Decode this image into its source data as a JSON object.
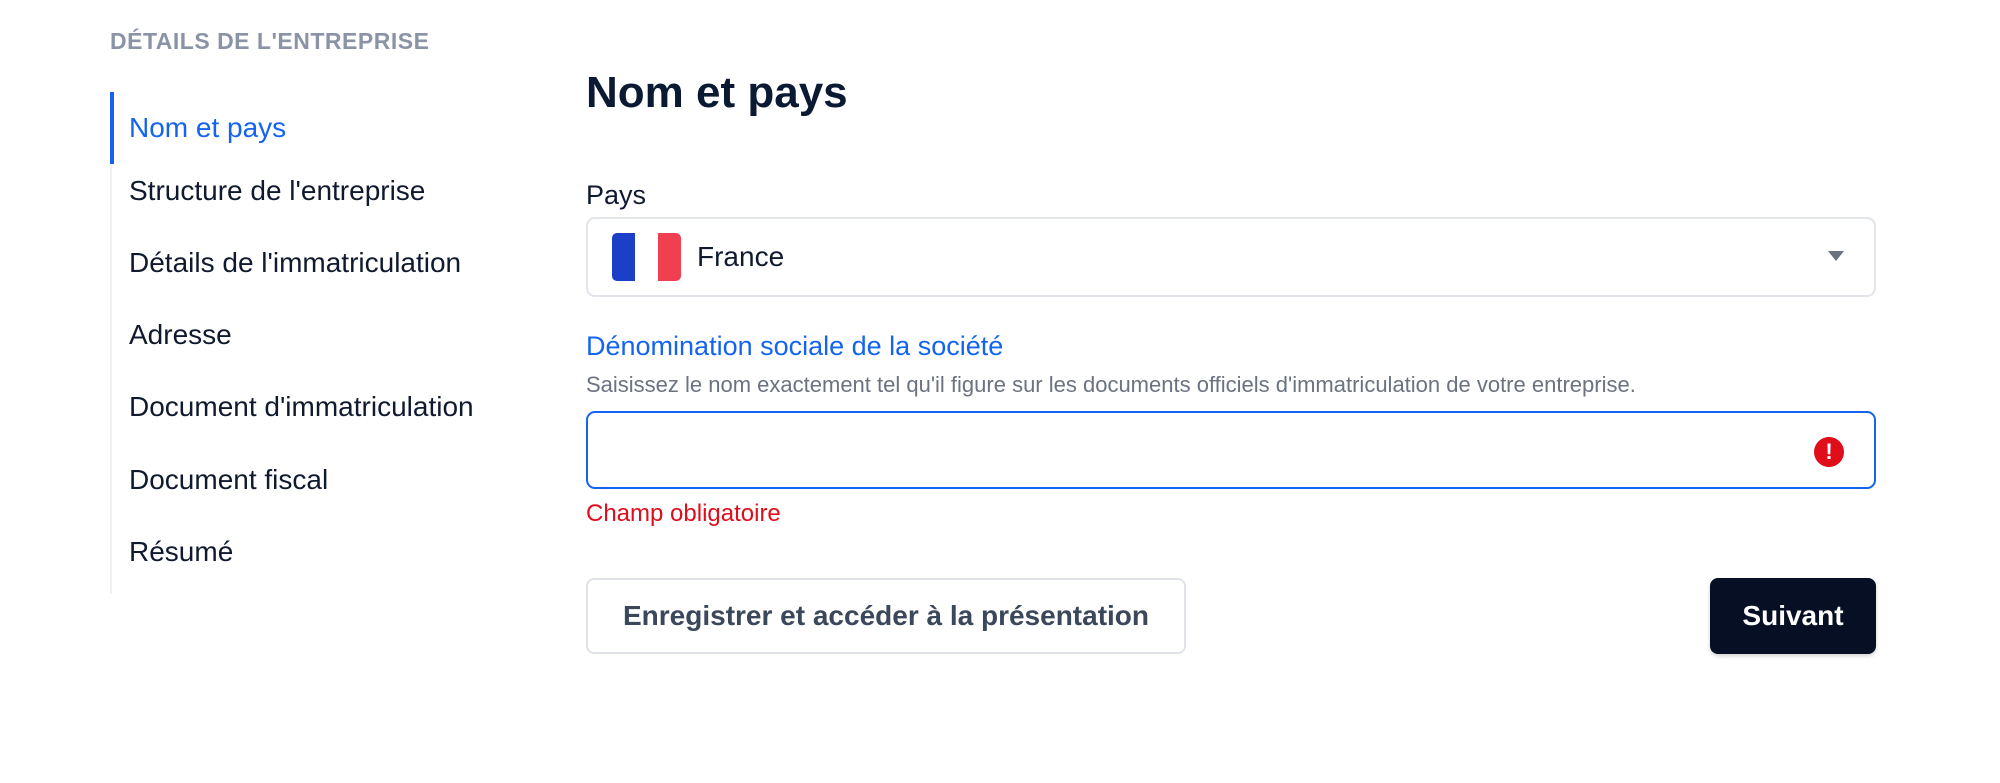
{
  "sidebar": {
    "heading": "DÉTAILS DE L'ENTREPRISE",
    "items": [
      {
        "label": "Nom et pays",
        "active": true
      },
      {
        "label": "Structure de l'entreprise",
        "active": false
      },
      {
        "label": "Détails de l'immatriculation",
        "active": false
      },
      {
        "label": "Adresse",
        "active": false
      },
      {
        "label": "Document d'immatriculation",
        "active": false
      },
      {
        "label": "Document fiscal",
        "active": false
      },
      {
        "label": "Résumé",
        "active": false
      }
    ]
  },
  "main": {
    "title": "Nom et pays",
    "country": {
      "label": "Pays",
      "value": "France",
      "flag_icon": "france-flag-icon"
    },
    "company_name": {
      "label": "Dénomination sociale de la société",
      "helper": "Saisissez le nom exactement tel qu'il figure sur les documents officiels d'immatriculation de votre entreprise.",
      "value": "",
      "error": "Champ obligatoire",
      "error_icon": "alert-circle-icon"
    },
    "buttons": {
      "save": "Enregistrer et accéder à la présentation",
      "next": "Suivant"
    }
  },
  "colors": {
    "accent": "#1464f0",
    "error": "#e00d1a",
    "primary_button": "#060f24",
    "muted": "#8a94a6"
  }
}
